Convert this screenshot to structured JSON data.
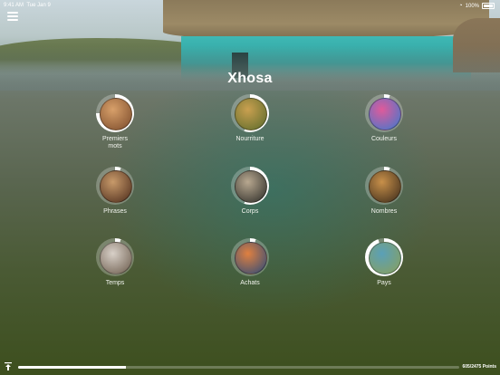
{
  "status_bar": {
    "time": "9:41 AM",
    "date": "Tue Jan 9",
    "battery": "100%"
  },
  "header": {
    "title": "Xhosa"
  },
  "topics": [
    {
      "label": "Premiers\nmots",
      "progress": 0.75,
      "colors": [
        "#d8a06a",
        "#7a4a2a"
      ]
    },
    {
      "label": "Nourriture",
      "progress": 0.55,
      "colors": [
        "#caa050",
        "#5a6a2a"
      ]
    },
    {
      "label": "Couleurs",
      "progress": 0.05,
      "colors": [
        "#e05a9a",
        "#3a7ad0"
      ]
    },
    {
      "label": "Phrases",
      "progress": 0.05,
      "colors": [
        "#c89a6a",
        "#4a2a1a"
      ]
    },
    {
      "label": "Corps",
      "progress": 0.55,
      "colors": [
        "#b8a890",
        "#2a2a26"
      ]
    },
    {
      "label": "Nombres",
      "progress": 0.05,
      "colors": [
        "#c8904a",
        "#3a2a1a"
      ]
    },
    {
      "label": "Temps",
      "progress": 0.05,
      "colors": [
        "#d8d0c8",
        "#6a5a4a"
      ]
    },
    {
      "label": "Achats",
      "progress": 0.05,
      "colors": [
        "#e08040",
        "#2a4a7a"
      ]
    },
    {
      "label": "Pays",
      "progress": 0.95,
      "colors": [
        "#5aa0b8",
        "#8aa05a"
      ]
    }
  ],
  "footer": {
    "points_text": "605/2475 Points",
    "progress": 0.245
  },
  "colors": {
    "ring_complete": "#ffffff",
    "ring_track": "rgba(255,255,255,0.25)"
  }
}
